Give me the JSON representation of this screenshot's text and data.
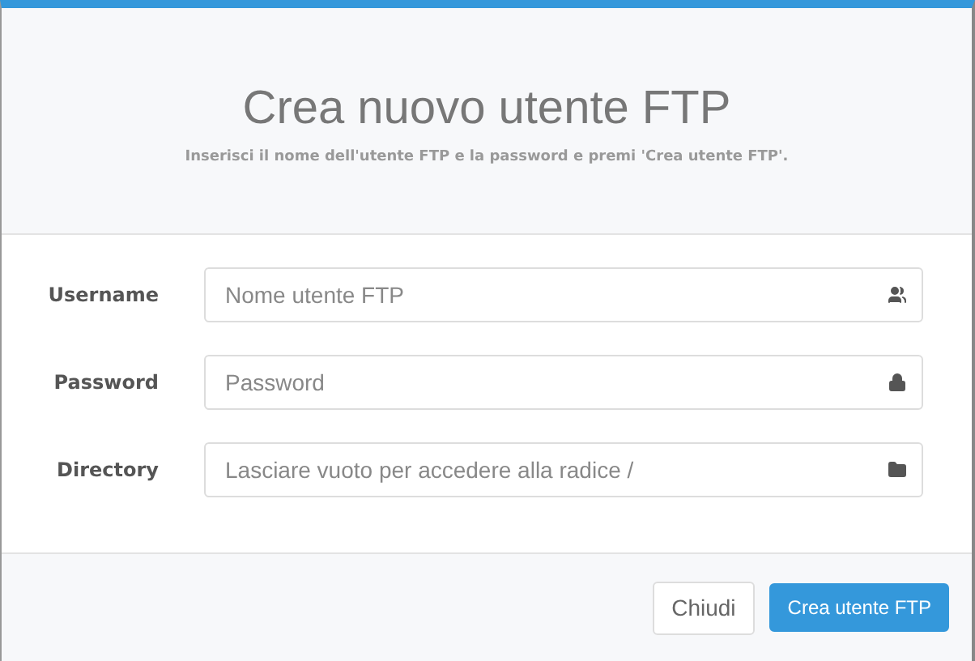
{
  "header": {
    "title": "Crea nuovo utente FTP",
    "subtitle": "Inserisci il nome dell'utente FTP e la password e premi 'Crea utente FTP'."
  },
  "fields": [
    {
      "label": "Username",
      "placeholder": "Nome utente FTP"
    },
    {
      "label": "Password",
      "placeholder": "Password"
    },
    {
      "label": "Directory",
      "placeholder": "Lasciare vuoto per accedere alla radice /"
    }
  ],
  "buttons": [
    {
      "label": "Chiudi",
      "kind": "default"
    },
    {
      "label": "Crea utente FTP",
      "kind": "primary"
    }
  ]
}
